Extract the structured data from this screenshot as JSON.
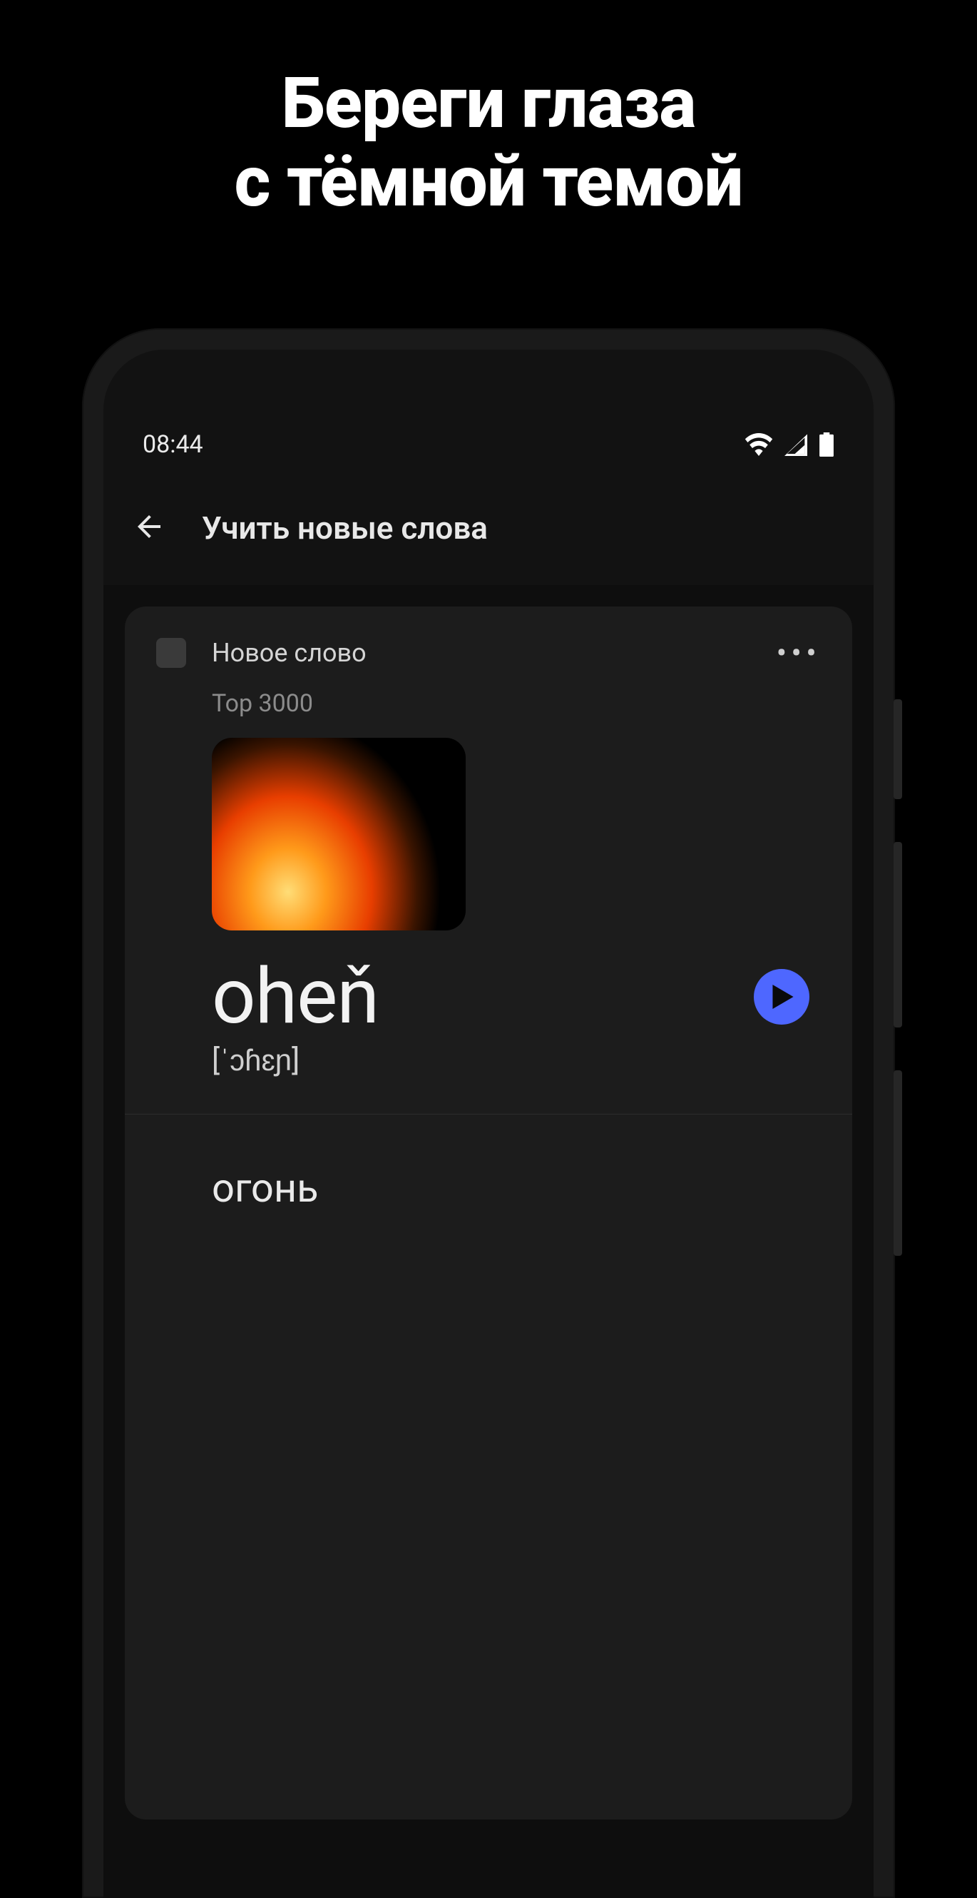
{
  "promo": {
    "line1": "Береги глаза",
    "line2": "с тёмной темой"
  },
  "statusbar": {
    "time": "08:44",
    "icons": {
      "wifi": "wifi-icon",
      "signal": "signal-icon",
      "battery": "battery-icon"
    }
  },
  "appbar": {
    "title": "Учить новые слова"
  },
  "card": {
    "chip": "Новое слово",
    "category": "Top 3000",
    "image_semantic": "fire",
    "word": "oheň",
    "ipa": "[ˈɔɦɛɲ]",
    "translation": "огонь",
    "more_label": "•••"
  },
  "colors": {
    "accent": "#4e67ff",
    "bg": "#000000",
    "surface": "#1c1c1c"
  }
}
